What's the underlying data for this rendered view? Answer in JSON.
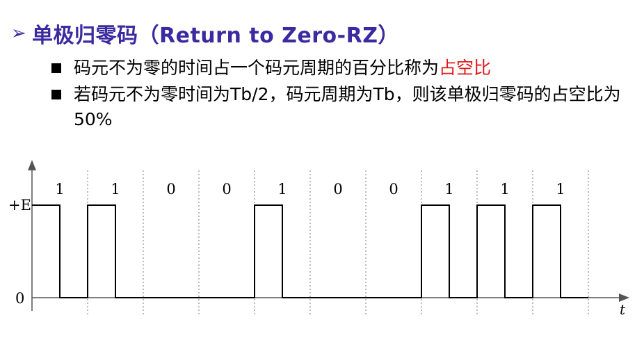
{
  "slide": {
    "title": "单极归零码（Return to Zero-RZ）",
    "bullets": [
      {
        "text_before": "码元不为零的时间占一个码元周期的百分比称为",
        "highlight": "占空比"
      },
      {
        "text": "若码元不为零时间为Tb/2，码元周期为Tb，则该单极归零码的占空比为50%"
      }
    ]
  },
  "chart_data": {
    "type": "line",
    "bits": [
      "1",
      "1",
      "0",
      "0",
      "1",
      "0",
      "0",
      "1",
      "1",
      "1"
    ],
    "y_levels": [
      "+E",
      "0"
    ],
    "x_axis_label": "t",
    "duty_cycle": 0.5,
    "colors": {
      "title": "#3b2aa0",
      "highlight": "#e0191b",
      "signal": "#000000",
      "divider": "#777777"
    }
  }
}
